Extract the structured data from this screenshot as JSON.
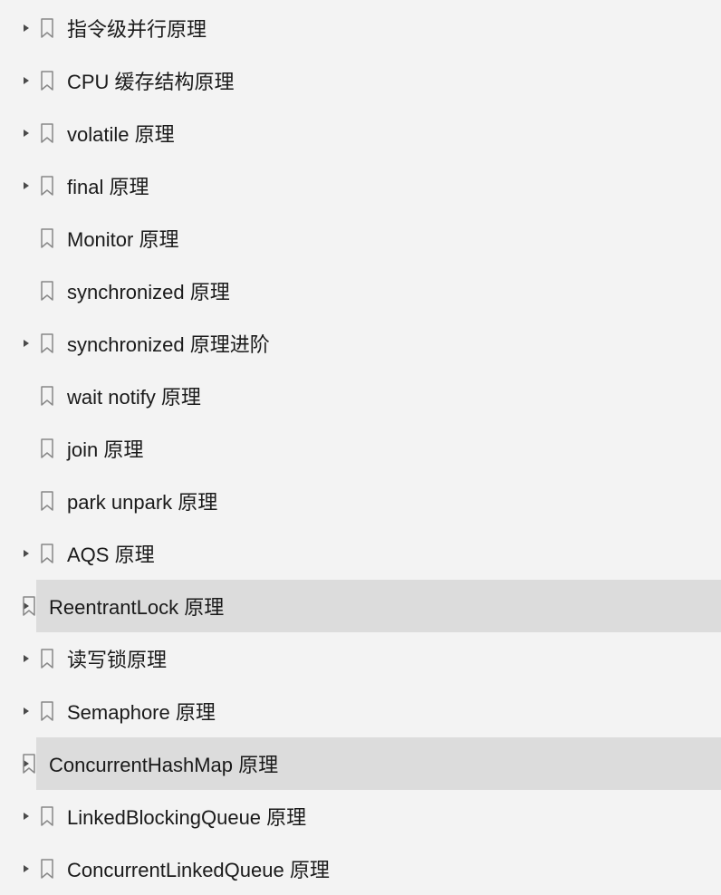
{
  "items": [
    {
      "label": "指令级并行原理",
      "expandable": true,
      "highlighted": false
    },
    {
      "label": "CPU 缓存结构原理",
      "expandable": true,
      "highlighted": false
    },
    {
      "label": "volatile 原理",
      "expandable": true,
      "highlighted": false
    },
    {
      "label": "final 原理",
      "expandable": true,
      "highlighted": false
    },
    {
      "label": "Monitor 原理",
      "expandable": false,
      "highlighted": false
    },
    {
      "label": "synchronized 原理",
      "expandable": false,
      "highlighted": false
    },
    {
      "label": "synchronized 原理进阶",
      "expandable": true,
      "highlighted": false
    },
    {
      "label": "wait notify 原理",
      "expandable": false,
      "highlighted": false
    },
    {
      "label": "join 原理",
      "expandable": false,
      "highlighted": false
    },
    {
      "label": "park unpark 原理",
      "expandable": false,
      "highlighted": false
    },
    {
      "label": "AQS 原理",
      "expandable": true,
      "highlighted": false
    },
    {
      "label": "ReentrantLock 原理",
      "expandable": true,
      "highlighted": true
    },
    {
      "label": "读写锁原理",
      "expandable": true,
      "highlighted": false
    },
    {
      "label": "Semaphore 原理",
      "expandable": true,
      "highlighted": false
    },
    {
      "label": "ConcurrentHashMap 原理",
      "expandable": true,
      "highlighted": true
    },
    {
      "label": "LinkedBlockingQueue 原理",
      "expandable": true,
      "highlighted": false
    },
    {
      "label": "ConcurrentLinkedQueue 原理",
      "expandable": true,
      "highlighted": false
    }
  ]
}
